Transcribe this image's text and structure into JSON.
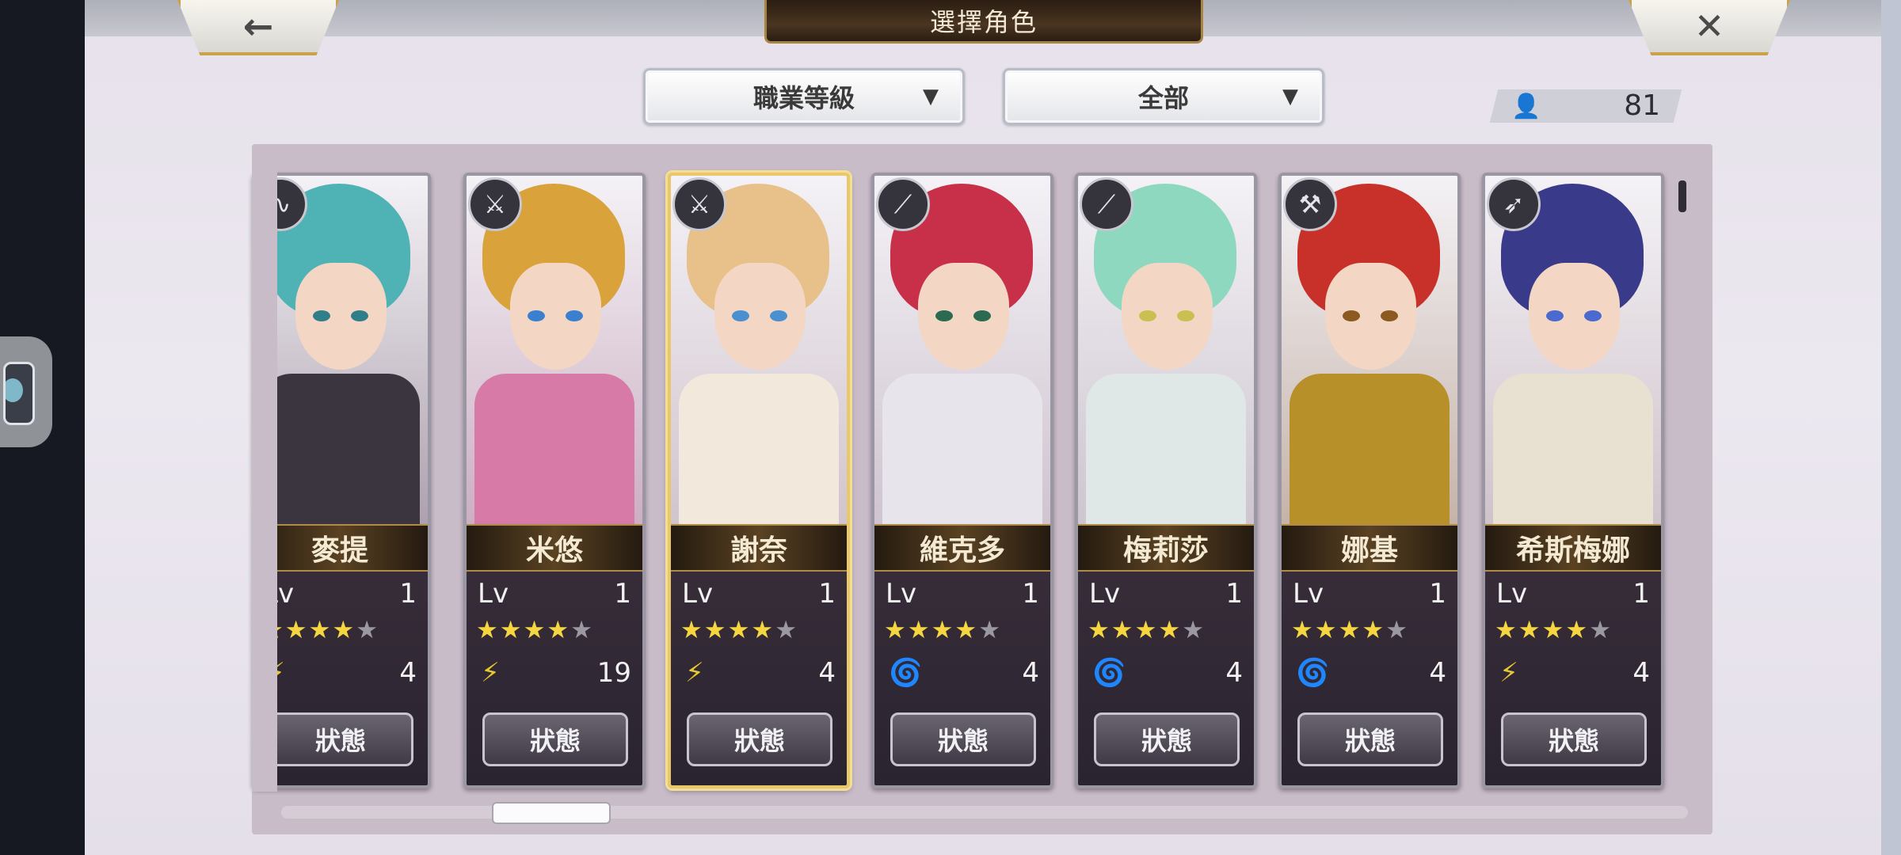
{
  "header": {
    "title": "選擇角色",
    "back_label": "←",
    "close_label": "✕"
  },
  "filters": {
    "class_filter": "職業等級",
    "scope_filter": "全部",
    "arrow": "▼"
  },
  "character_count": {
    "icon": "person-icon",
    "value": "81"
  },
  "colors": {
    "gold_border": "#c9a24a",
    "star_on": "#f5d640",
    "star_off": "#9a98a0"
  },
  "level_label": "Lv",
  "status_label": "狀態",
  "characters": [
    {
      "name": "麥提",
      "level": "1",
      "stars": 4,
      "max_stars": 5,
      "element": "thunder",
      "value": "4",
      "weapon": "staff-icon"
    },
    {
      "name": "米悠",
      "level": "1",
      "stars": 4,
      "max_stars": 5,
      "element": "thunder",
      "value": "19",
      "weapon": "sword-icon"
    },
    {
      "name": "謝奈",
      "level": "1",
      "stars": 4,
      "max_stars": 5,
      "element": "thunder",
      "value": "4",
      "weapon": "sword-icon",
      "selected": true
    },
    {
      "name": "維克多",
      "level": "1",
      "stars": 4,
      "max_stars": 5,
      "element": "wind",
      "value": "4",
      "weapon": "blade-icon"
    },
    {
      "name": "梅莉莎",
      "level": "1",
      "stars": 4,
      "max_stars": 5,
      "element": "wind",
      "value": "4",
      "weapon": "blade-icon"
    },
    {
      "name": "娜基",
      "level": "1",
      "stars": 4,
      "max_stars": 5,
      "element": "wind",
      "value": "4",
      "weapon": "axe-icon"
    },
    {
      "name": "希斯梅娜",
      "level": "1",
      "stars": 4,
      "max_stars": 5,
      "element": "thunder",
      "value": "4",
      "weapon": "spear-icon"
    }
  ]
}
